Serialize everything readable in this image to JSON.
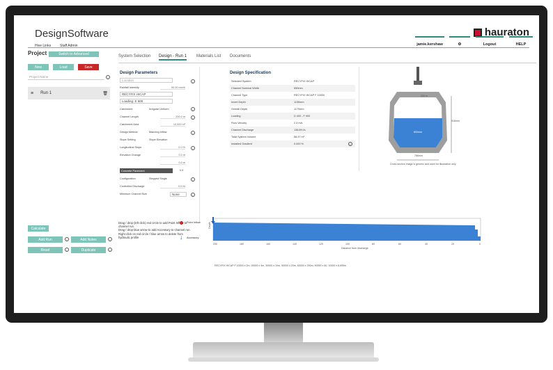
{
  "app": {
    "title": "DesignSoftware",
    "brand": "hauraton"
  },
  "topbar": {
    "links": [
      "Hive Links",
      "Staff Admin"
    ],
    "user": "jamie.kershaw",
    "logout": "Logout",
    "help": "HELP"
  },
  "project": {
    "title": "Project",
    "switch_label": "Switch to Advanced",
    "new_label": "New",
    "load_label": "Load",
    "save_label": "Save",
    "name_placeholder": "Project Name",
    "run_label": "Run 1",
    "calculate_label": "Calculate",
    "add_run_label": "Add Run",
    "add_notes_label": "Add Notes",
    "reset_label": "Reset",
    "duplicate_label": "Duplicate"
  },
  "tabs": [
    "System Selection",
    "Design - Run 1",
    "Materials List",
    "Documents"
  ],
  "design_parameters": {
    "title": "Design Parameters",
    "location_placeholder": "Location",
    "rows": [
      {
        "label": "Rainfall Intensity",
        "value": "50.00 mm/h"
      },
      {
        "label": "RECYFIX HICAP",
        "value": ""
      },
      {
        "label": "Loading: E 600",
        "value": ""
      },
      {
        "label": "Catchment",
        "value": "Irregular   Uniform"
      },
      {
        "label": "Channel Length",
        "value": "200.0 m"
      },
      {
        "label": "Catchment Area",
        "value": "10,000 m²"
      },
      {
        "label": "Design Method",
        "value": "Manning   Inflow"
      },
      {
        "label": "Slope Setting",
        "value": "Slope   Elevation"
      },
      {
        "label": "Longitudinal Slope",
        "value": "0.0 %"
      },
      {
        "label": "Elevation Change",
        "value": "0.0 m"
      },
      {
        "label": "",
        "value": "0.0 m"
      },
      {
        "label": "Concrete Pavement",
        "value": "0.9"
      },
      {
        "label": "Configuration",
        "value": "Stepped   Single"
      },
      {
        "label": "Controlled Discharge",
        "value": "0.0 l/s"
      },
      {
        "label": "Minimum Channel Size",
        "value": "None"
      }
    ]
  },
  "design_specification": {
    "title": "Design Specification",
    "rows": [
      {
        "label": "Selected System",
        "value": "RECYFIX HICAP"
      },
      {
        "label": "Channel Nominal Width",
        "value": "650mm"
      },
      {
        "label": "Channel Type",
        "value": "RECYFIX HICAP F 10000"
      },
      {
        "label": "Invert Depth",
        "value": "1130mm"
      },
      {
        "label": "Overall Depth",
        "value": "1170mm"
      },
      {
        "label": "Loading",
        "value": "D 400 - F 900"
      },
      {
        "label": "Flow Velocity",
        "value": "2.3 m/s"
      },
      {
        "label": "Channel Discharge",
        "value": "138.89 l/s"
      },
      {
        "label": "Total System Volume",
        "value": "58.37 m³"
      },
      {
        "label": "Installed Gradient",
        "value": "0.000 %"
      }
    ]
  },
  "cross_section": {
    "dim_top": "200 m",
    "dim_right": "918mm",
    "dim_inner": "800mm",
    "dim_bottom": "786mm",
    "caption": "Cross section image is generic and used for illustration only"
  },
  "instructions": [
    "Drag / drop (left click) red circle to add Point Inflow to channel run.",
    "Drag / drop blue arrow to add Accessory to channel run.",
    "Right click on red circle / blue arrow to delete from hydraulic profile"
  ],
  "legend": {
    "point_inflow": "Point Inflow",
    "accessory": "Accessory"
  },
  "profile": {
    "ylabel": "Depth",
    "xlabel": "Distance from discharge",
    "ticks": [
      "200",
      "180",
      "160",
      "140",
      "120",
      "100",
      "80",
      "60",
      "40",
      "20",
      "0"
    ],
    "summary": "RECYFIX HICAP F 10000 x 2m, 20000 x 4m, 30000 x 10m, 50000 x 20m, 60000 x 250m, 90000 x 60, 10000 x 8,695m"
  },
  "colors": {
    "accent": "#2e8b7f",
    "button": "#7fc4b9",
    "save": "#c62828",
    "water": "#3b82d4"
  }
}
